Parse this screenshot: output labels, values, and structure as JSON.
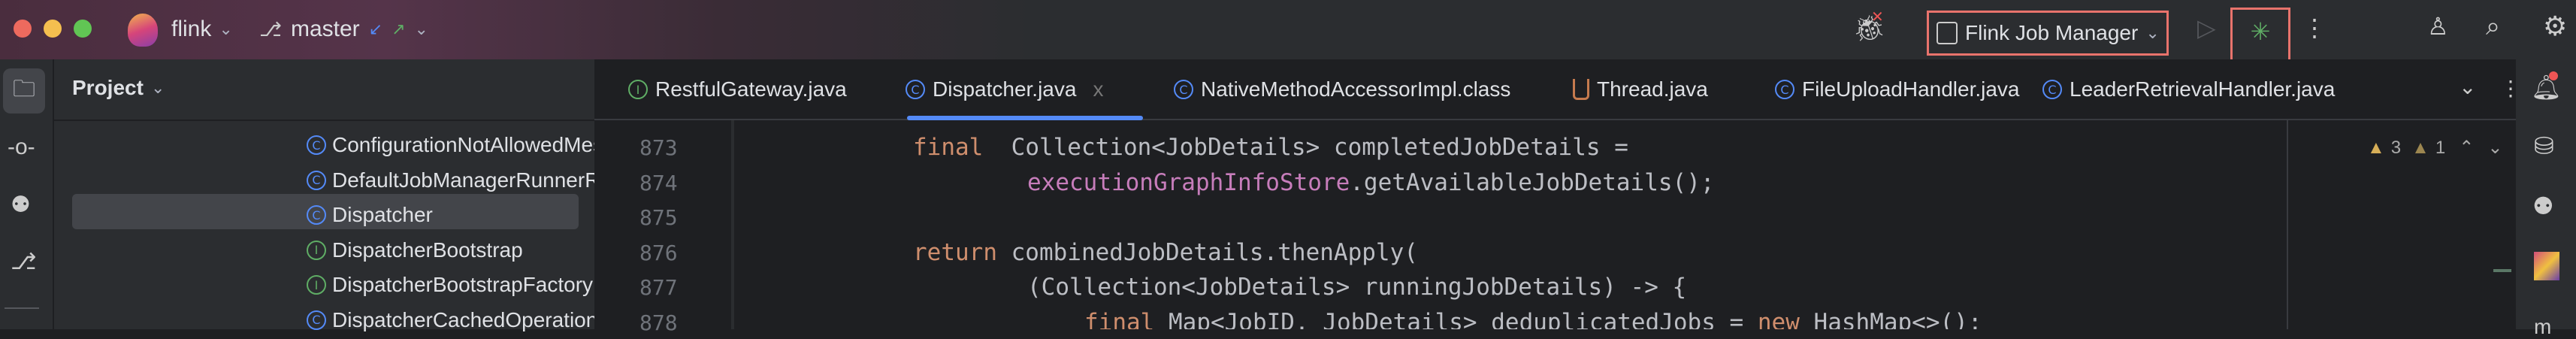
{
  "titlebar": {
    "project": "flink",
    "branch": "master",
    "run_config": "Flink Job Manager"
  },
  "project_panel": {
    "title": "Project",
    "items": [
      {
        "label": "ConfigurationNotAllowedMes",
        "kind": "class"
      },
      {
        "label": "DefaultJobManagerRunnerRe",
        "kind": "class"
      },
      {
        "label": "Dispatcher",
        "kind": "class",
        "selected": true
      },
      {
        "label": "DispatcherBootstrap",
        "kind": "interface"
      },
      {
        "label": "DispatcherBootstrapFactory",
        "kind": "interface"
      },
      {
        "label": "DispatcherCachedOperations",
        "kind": "class"
      }
    ]
  },
  "tabs": [
    {
      "label": "RestfulGateway.java",
      "kind": "interface"
    },
    {
      "label": "Dispatcher.java",
      "kind": "class",
      "active": true
    },
    {
      "label": "NativeMethodAccessorImpl.class",
      "kind": "class"
    },
    {
      "label": "Thread.java",
      "kind": "java"
    },
    {
      "label": "FileUploadHandler.java",
      "kind": "class"
    },
    {
      "label": "LeaderRetrievalHandler.java",
      "kind": "class"
    }
  ],
  "tab_close": "x",
  "icons": {
    "class": "C",
    "interface": "I"
  },
  "inspections": {
    "warnings": "3",
    "weak_warnings": "1"
  },
  "colors": {
    "accent": "#548af7",
    "highlight": "#e8736c",
    "debug": "#5fad65"
  },
  "editor": {
    "lines": [
      {
        "num": "873",
        "indent": 0,
        "tokens": [
          [
            "kw",
            "final"
          ],
          [
            "",
            "  Collection<JobDetails> completedJobDetails ="
          ]
        ]
      },
      {
        "num": "874",
        "indent": 8,
        "tokens": [
          [
            "fld",
            "executionGraphInfoStore"
          ],
          [
            "",
            ".getAvailableJobDetails();"
          ]
        ]
      },
      {
        "num": "875",
        "indent": 0,
        "tokens": []
      },
      {
        "num": "876",
        "indent": 0,
        "tokens": [
          [
            "kw",
            "return"
          ],
          [
            "",
            " combinedJobDetails.thenApply("
          ]
        ]
      },
      {
        "num": "877",
        "indent": 8,
        "tokens": [
          [
            "",
            "(Collection<JobDetails> runningJobDetails) -> {"
          ]
        ]
      },
      {
        "num": "878",
        "indent": 12,
        "tokens": [
          [
            "kw",
            "final"
          ],
          [
            "",
            " Map<JobID, JobDetails> deduplicatedJobs = "
          ],
          [
            "kw",
            "new"
          ],
          [
            "",
            " HashMap<>();"
          ]
        ]
      }
    ]
  }
}
